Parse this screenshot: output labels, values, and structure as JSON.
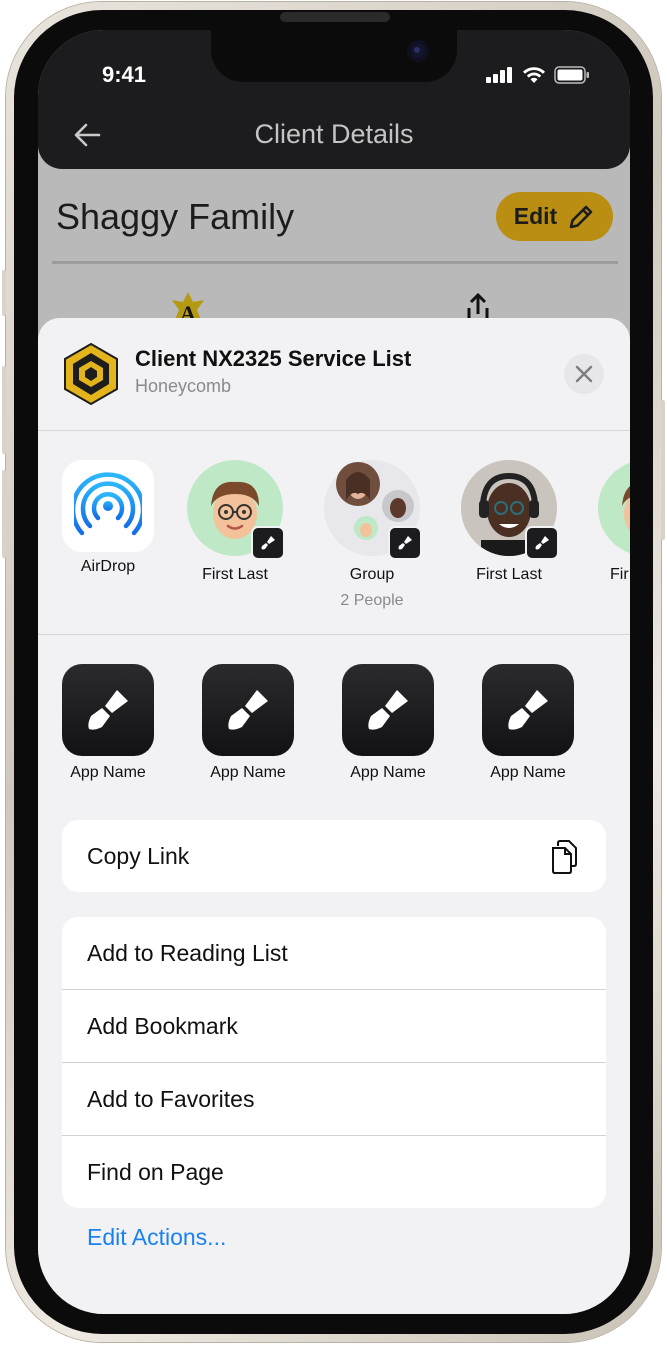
{
  "status_bar": {
    "time": "9:41"
  },
  "header": {
    "title": "Client Details",
    "back_icon": "arrow-left-icon"
  },
  "client": {
    "name": "Shaggy Family",
    "edit_label": "Edit"
  },
  "share_sheet": {
    "title": "Client NX2325 Service List",
    "subtitle": "Honeycomb",
    "targets": [
      {
        "label": "AirDrop",
        "sub": ""
      },
      {
        "label": "First Last",
        "sub": ""
      },
      {
        "label": "Group",
        "sub": "2 People"
      },
      {
        "label": "First Last",
        "sub": ""
      },
      {
        "label": "Fir",
        "sub": ""
      }
    ],
    "apps": [
      "App Name",
      "App Name",
      "App Name",
      "App Name"
    ],
    "copy_link": "Copy Link",
    "actions": [
      "Add to Reading List",
      "Add Bookmark",
      "Add to Favorites",
      "Find on Page"
    ],
    "edit_actions": "Edit Actions..."
  },
  "colors": {
    "accent": "#b98e12",
    "link": "#1a82ee",
    "header_bg": "#1c1c1e",
    "sheet_bg": "#f2f2f4"
  }
}
